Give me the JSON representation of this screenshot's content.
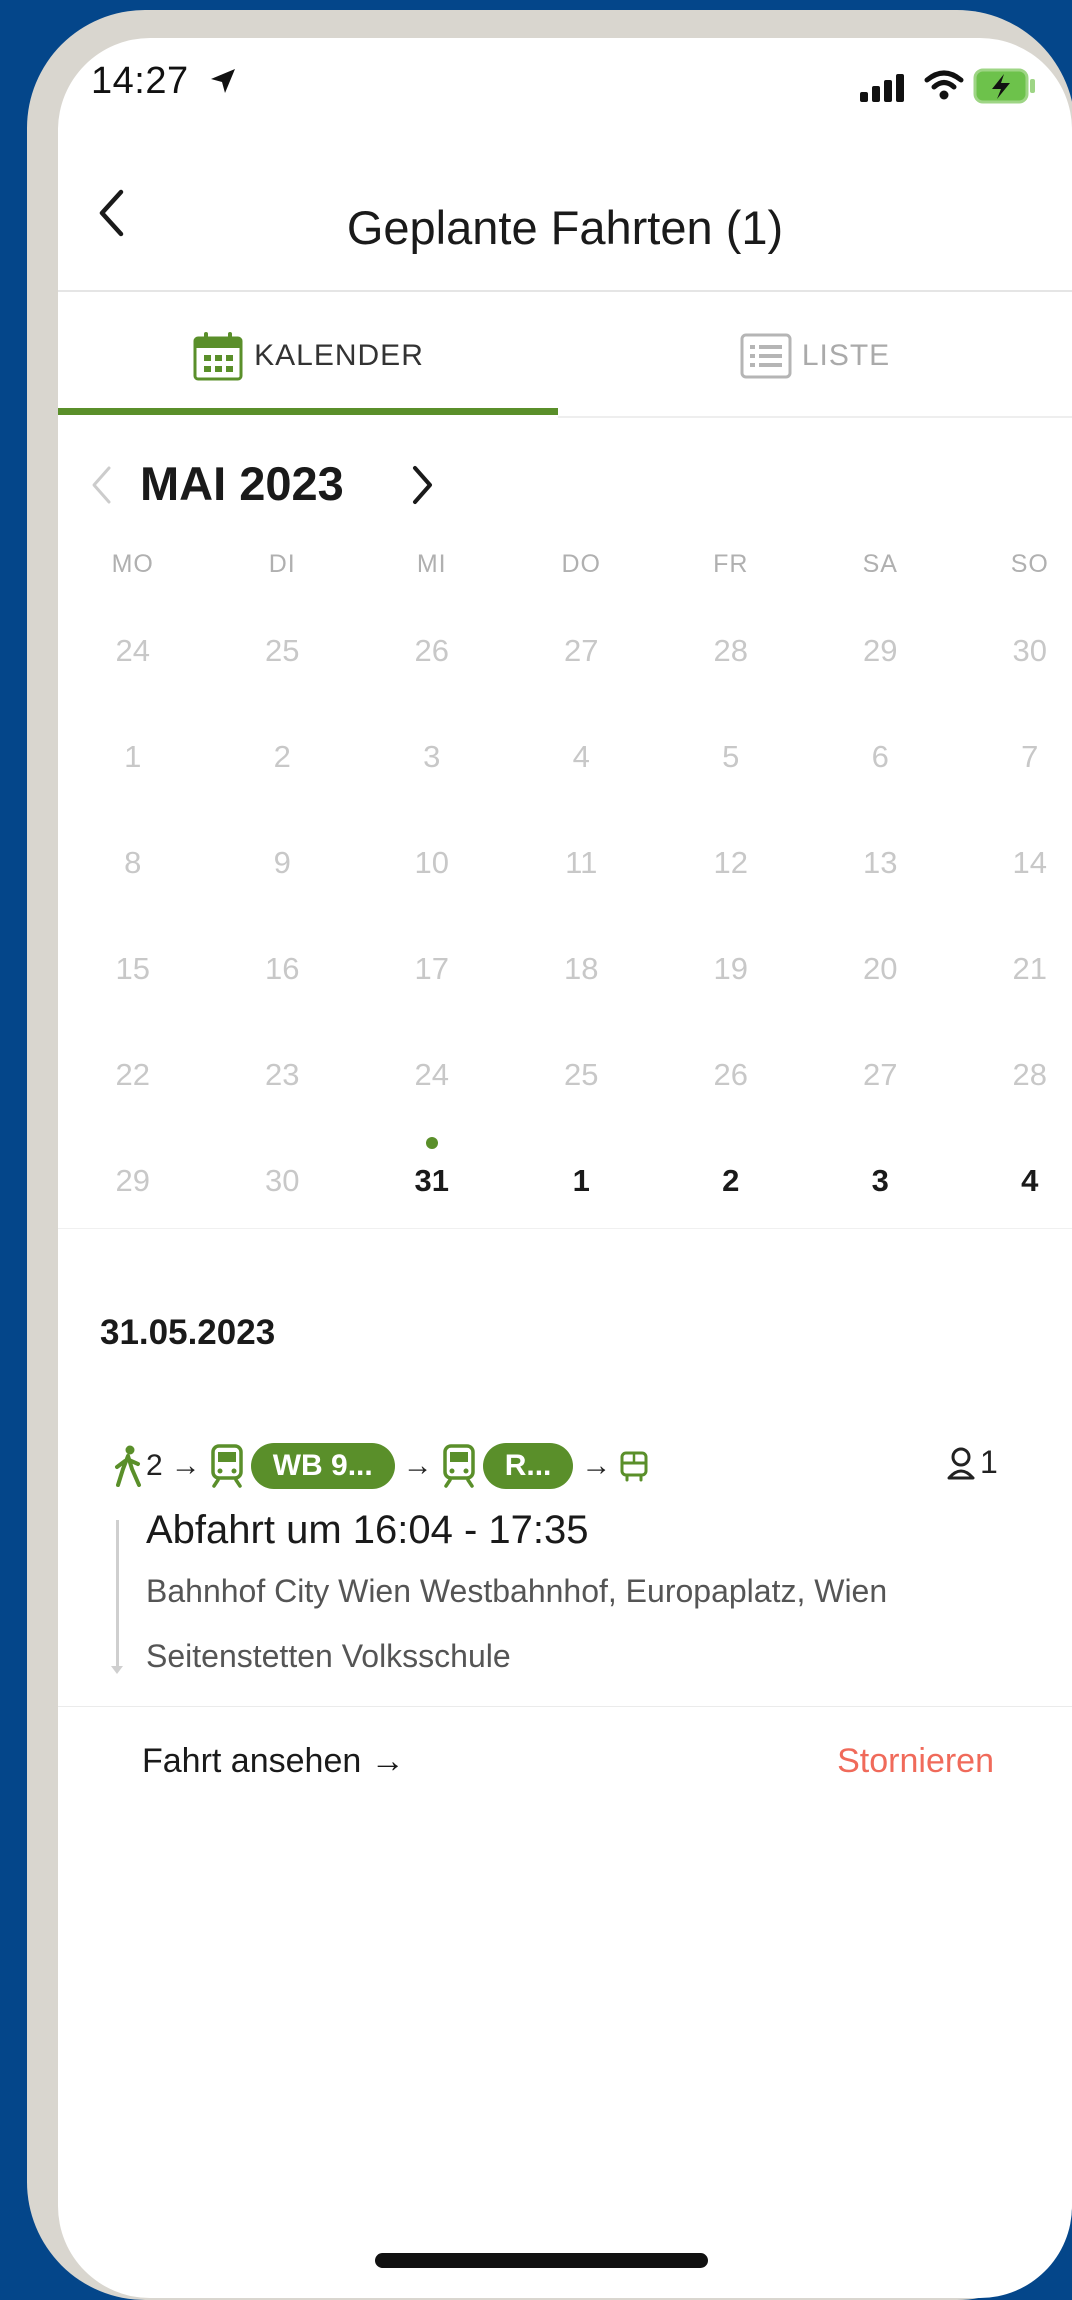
{
  "status_bar": {
    "time": "14:27"
  },
  "header": {
    "title": "Geplante Fahrten (1)"
  },
  "tabs": [
    {
      "label": "KALENDER",
      "active": true
    },
    {
      "label": "LISTE",
      "active": false
    }
  ],
  "calendar": {
    "month_title": "MAI 2023",
    "weekdays": [
      "MO",
      "DI",
      "MI",
      "DO",
      "FR",
      "SA",
      "SO"
    ],
    "weeks": [
      [
        "24",
        "25",
        "26",
        "27",
        "28",
        "29",
        "30"
      ],
      [
        "1",
        "2",
        "3",
        "4",
        "5",
        "6",
        "7"
      ],
      [
        "8",
        "9",
        "10",
        "11",
        "12",
        "13",
        "14"
      ],
      [
        "15",
        "16",
        "17",
        "18",
        "19",
        "20",
        "21"
      ],
      [
        "22",
        "23",
        "24",
        "25",
        "26",
        "27",
        "28"
      ],
      [
        "29",
        "30",
        "31",
        "1",
        "2",
        "3",
        "4"
      ]
    ]
  },
  "trip": {
    "date": "31.05.2023",
    "walk_minutes": "2",
    "lines": [
      "WB 9...",
      "R..."
    ],
    "passengers": "1",
    "departure": "Abfahrt um 16:04 - 17:35",
    "from": "Bahnhof City Wien Westbahnhof, Europaplatz, Wien",
    "to": "Seitenstetten Volksschule",
    "view_label": "Fahrt ansehen →",
    "cancel_label": "Stornieren"
  },
  "colors": {
    "accent": "#5a8f2a",
    "cancel": "#f06a5a",
    "background": "#04468a"
  }
}
